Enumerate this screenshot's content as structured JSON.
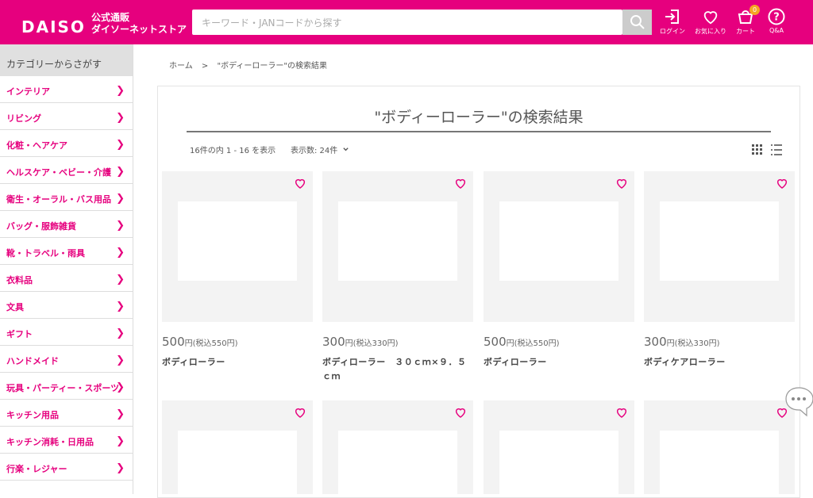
{
  "header": {
    "logo": "DAISO",
    "logo_sub_line1": "公式通販",
    "logo_sub_line2": "ダイソーネットストア",
    "search_placeholder": "キーワード・JANコードから探す",
    "login_label": "ログイン",
    "favorites_label": "お気に入り",
    "cart_label": "カート",
    "cart_count": "0",
    "qa_label": "Q&A",
    "brand_color": "#e6007e"
  },
  "sidebar": {
    "heading": "カテゴリーからさがす",
    "items": [
      "インテリア",
      "リビング",
      "化粧・ヘアケア",
      "ヘルスケア・ベビー・介護",
      "衛生・オーラル・バス用品",
      "バッグ・服飾雑貨",
      "靴・トラベル・雨具",
      "衣料品",
      "文具",
      "ギフト",
      "ハンドメイド",
      "玩具・パーティー・スポーツ",
      "キッチン用品",
      "キッチン消耗・日用品",
      "行楽・レジャー"
    ]
  },
  "breadcrumb": {
    "home": "ホーム",
    "sep": ">",
    "current": "\"ボディーローラー\"の検索結果"
  },
  "results": {
    "title": "\"ボディーローラー\"の検索結果",
    "count_text": "16件の内 1 - 16 を表示",
    "per_page": "表示数: 24件"
  },
  "products": [
    {
      "price": "500",
      "unit": "円(税込550円)",
      "name": "ボディローラー"
    },
    {
      "price": "300",
      "unit": "円(税込330円)",
      "name": "ボディローラー　３０ｃｍ×９．５ｃｍ"
    },
    {
      "price": "500",
      "unit": "円(税込550円)",
      "name": "ボディローラー"
    },
    {
      "price": "300",
      "unit": "円(税込330円)",
      "name": "ボディケアローラー"
    }
  ]
}
